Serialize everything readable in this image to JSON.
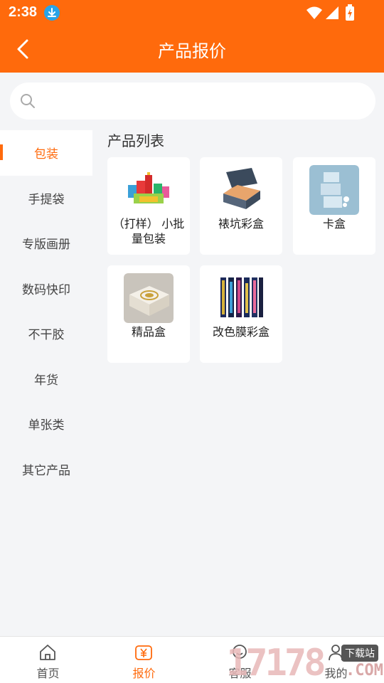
{
  "status_bar": {
    "time": "2:38"
  },
  "header": {
    "title": "产品报价"
  },
  "search": {
    "placeholder": ""
  },
  "sidebar": {
    "items": [
      {
        "label": "包装",
        "active": true
      },
      {
        "label": "手提袋",
        "active": false
      },
      {
        "label": "专版画册",
        "active": false
      },
      {
        "label": "数码快印",
        "active": false
      },
      {
        "label": "不干胶",
        "active": false
      },
      {
        "label": "年货",
        "active": false
      },
      {
        "label": "单张类",
        "active": false
      },
      {
        "label": "其它产品",
        "active": false
      }
    ]
  },
  "main": {
    "section_title": "产品列表",
    "products": [
      {
        "label": "（打样） 小批量包装",
        "image": "packaging-assortment-image"
      },
      {
        "label": "裱坑彩盒",
        "image": "mailer-box-image"
      },
      {
        "label": "卡盒",
        "image": "card-box-image"
      },
      {
        "label": "精品盒",
        "image": "gift-box-image"
      },
      {
        "label": "改色膜彩盒",
        "image": "color-film-box-image"
      }
    ]
  },
  "tabbar": {
    "tabs": [
      {
        "label": "首页",
        "icon": "home-icon",
        "active": false
      },
      {
        "label": "报价",
        "icon": "quote-yen-icon",
        "active": true
      },
      {
        "label": "客服",
        "icon": "customer-service-icon",
        "active": false
      },
      {
        "label": "我的",
        "icon": "user-icon",
        "active": false
      }
    ]
  },
  "watermark": {
    "digits": "17178",
    "tag": "下载站",
    "suffix": ".COM"
  },
  "colors": {
    "accent": "#ff6a0c",
    "background": "#f4f5f7"
  }
}
